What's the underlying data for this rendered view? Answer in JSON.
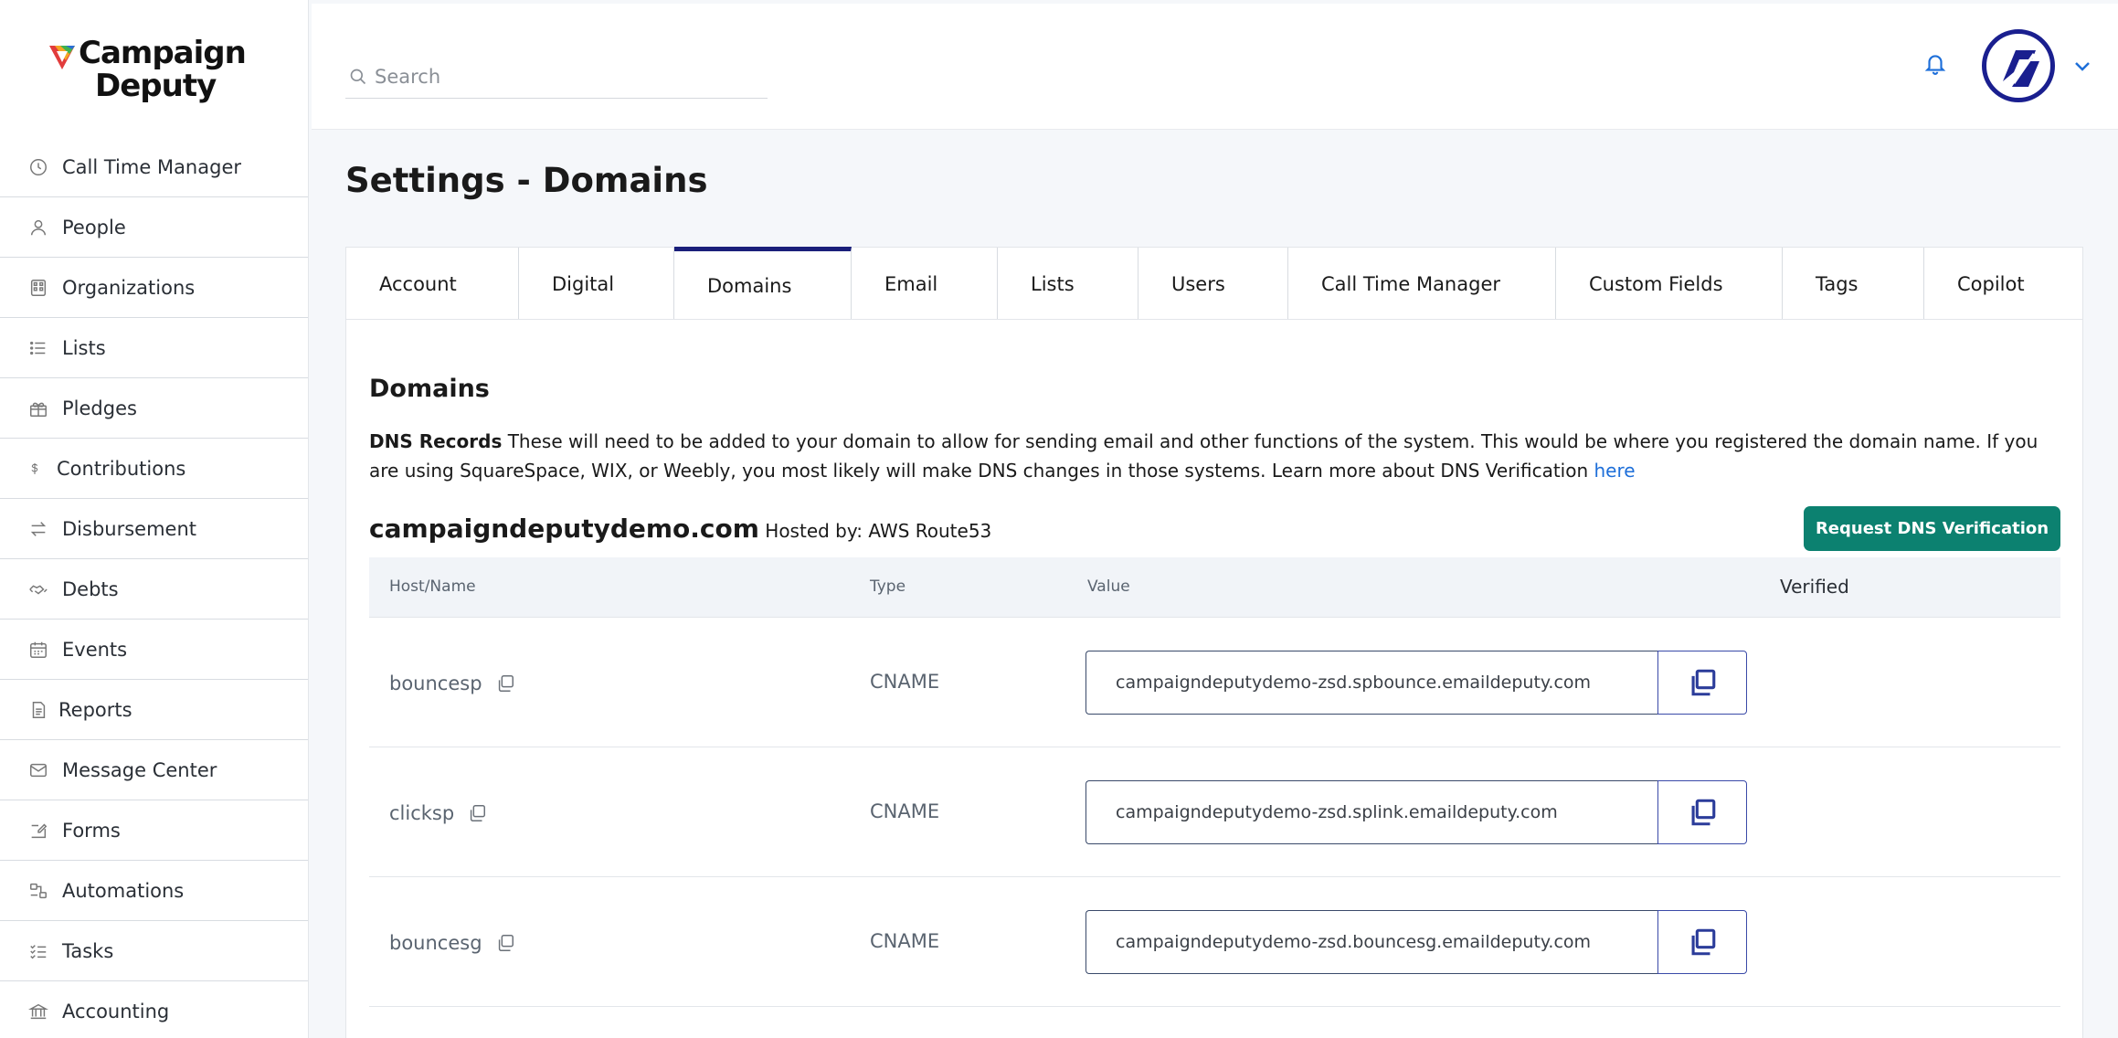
{
  "brand": {
    "line1": "Campaign",
    "line2": "Deputy"
  },
  "sidebar": {
    "items": [
      {
        "label": "Call Time Manager",
        "icon": "clock-icon"
      },
      {
        "label": "People",
        "icon": "person-icon"
      },
      {
        "label": "Organizations",
        "icon": "building-icon"
      },
      {
        "label": "Lists",
        "icon": "list-icon"
      },
      {
        "label": "Pledges",
        "icon": "gift-icon"
      },
      {
        "label": "Contributions",
        "icon": "dollar-icon"
      },
      {
        "label": "Disbursement",
        "icon": "transfer-icon"
      },
      {
        "label": "Debts",
        "icon": "handshake-icon"
      },
      {
        "label": "Events",
        "icon": "calendar-icon"
      },
      {
        "label": "Reports",
        "icon": "document-icon"
      },
      {
        "label": "Message Center",
        "icon": "mail-icon"
      },
      {
        "label": "Forms",
        "icon": "form-edit-icon"
      },
      {
        "label": "Automations",
        "icon": "automation-icon"
      },
      {
        "label": "Tasks",
        "icon": "checklist-icon"
      },
      {
        "label": "Accounting",
        "icon": "bank-icon"
      }
    ]
  },
  "header": {
    "search_placeholder": "Search"
  },
  "page": {
    "title": "Settings - Domains"
  },
  "tabs": [
    {
      "label": "Account"
    },
    {
      "label": "Digital"
    },
    {
      "label": "Domains"
    },
    {
      "label": "Email"
    },
    {
      "label": "Lists"
    },
    {
      "label": "Users"
    },
    {
      "label": "Call Time Manager"
    },
    {
      "label": "Custom Fields"
    },
    {
      "label": "Tags"
    },
    {
      "label": "Copilot"
    }
  ],
  "active_tab": "Domains",
  "domains": {
    "title": "Domains",
    "dns_label": "DNS Records",
    "dns_text": " These will need to be added to your domain to allow for sending email and other functions of the system. This would be where you registered the domain name. If you are using SquareSpace, WIX, or Weebly, you most likely will make DNS changes in those systems. Learn more about DNS Verification ",
    "dns_link": "here",
    "domain_name": "campaigndeputydemo.com",
    "hosted_by": " Hosted by: AWS Route53",
    "verify_button": "Request DNS Verification",
    "columns": {
      "host": "Host/Name",
      "type": "Type",
      "value": "Value",
      "verified": "Verified"
    },
    "records": [
      {
        "host": "bouncesp",
        "type": "CNAME",
        "value": "campaigndeputydemo-zsd.spbounce.emaildeputy.com"
      },
      {
        "host": "clicksp",
        "type": "CNAME",
        "value": "campaigndeputydemo-zsd.splink.emaildeputy.com"
      },
      {
        "host": "bouncesg",
        "type": "CNAME",
        "value": "campaigndeputydemo-zsd.bouncesg.emaildeputy.com"
      }
    ]
  },
  "colors": {
    "accent_blue": "#1e6fd9",
    "tab_active": "#1a1f7a",
    "verify_green": "#0c8170"
  }
}
